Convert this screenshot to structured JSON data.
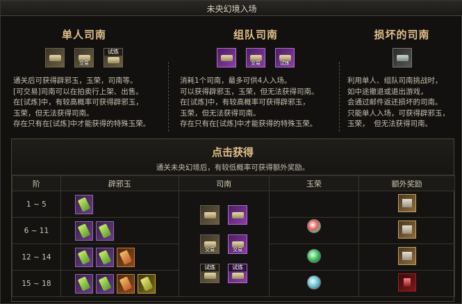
{
  "window": {
    "title": "未央幻境入场"
  },
  "sections": [
    {
      "title": "单人司南",
      "icons": [
        {
          "name": "compass-icon",
          "kind": "gold",
          "label": "",
          "toplabel": ""
        },
        {
          "name": "compass-trade-icon",
          "kind": "gold",
          "label": "交易",
          "toplabel": ""
        },
        {
          "name": "compass-trial-icon",
          "kind": "gold",
          "label": "",
          "toplabel": "试炼"
        }
      ],
      "desc": "通关后可获得辟邪玉，玉荣，司南等。\n[可交易]司南可以在拍卖行上架、出售。\n在[试炼]中，有较高概率可获得辟邪玉，\n玉荣，但无法获得司南。\n存在只有在[试炼]中才能获得的特殊玉荣。"
    },
    {
      "title": "组队司南",
      "icons": [
        {
          "name": "team-compass-icon",
          "kind": "purple",
          "label": "",
          "toplabel": ""
        },
        {
          "name": "team-compass-trade-icon",
          "kind": "purple",
          "label": "交易",
          "toplabel": ""
        },
        {
          "name": "team-compass-trial-icon",
          "kind": "purple",
          "label": "",
          "toplabel": "试炼"
        }
      ],
      "desc": "消耗1个司南，最多可供4人入场。\n可以获得辟邪玉，玉荣，但无法获得司南。\n在[试炼]中，有较高概率可获得辟邪玉，\n玉荣，但无法获得司南。\n存在只有在[试炼]中才能获得的特殊玉荣。"
    },
    {
      "title": "损坏的司南",
      "icons": [
        {
          "name": "broken-compass-icon",
          "kind": "gray",
          "label": "",
          "toplabel": ""
        }
      ],
      "desc": "利用单人、组队司南挑战时，\n如中途撤退或退出游戏，\n会通过邮件返还损坏的司南。\n只能单人入场，可获得辟邪玉，\n玉荣，  但无法获得司南。"
    }
  ],
  "panel": {
    "title": "点击获得",
    "subtitle": "通关未央幻境后，有较低概率可获得额外奖励。",
    "headers": [
      "阶",
      "辟邪玉",
      "司南",
      "玉荣",
      "额外奖励"
    ],
    "rows": [
      {
        "tier": "1 ~ 5"
      },
      {
        "tier": "6 ~ 11"
      },
      {
        "tier": "12 ~ 14"
      },
      {
        "tier": "15 ~ 18"
      }
    ],
    "compass_labels": {
      "trade": "交易",
      "trial": "试炼"
    }
  }
}
